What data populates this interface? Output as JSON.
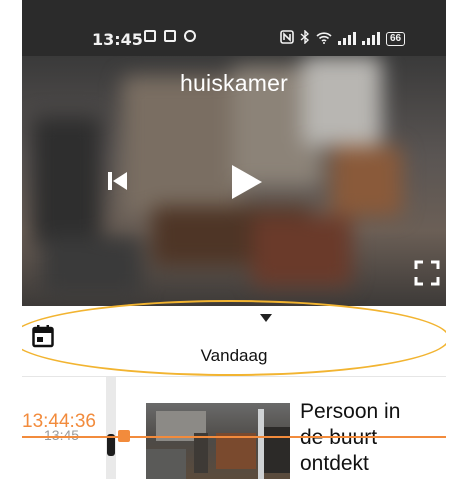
{
  "statusbar": {
    "time": "13:45",
    "left_icons": [
      "notification-icon",
      "notification-icon",
      "record-icon"
    ],
    "right_icons": [
      "nfc-icon",
      "bluetooth-icon",
      "wifi-icon",
      "signal-icon",
      "signal-icon"
    ],
    "battery": "66"
  },
  "camera": {
    "title": "huiskamer",
    "controls": [
      "skip-previous-icon",
      "play-icon",
      "fullscreen-icon"
    ]
  },
  "date_picker": {
    "label": "Vandaag",
    "icons": [
      "calendar-icon",
      "chevron-down-icon"
    ]
  },
  "timeline": {
    "current_time": "13:44:36",
    "tick_time": "13:45",
    "event": {
      "line1": "Persoon in",
      "line2": "de buurt",
      "line3": "ontdekt"
    }
  },
  "colors": {
    "accent": "#f28b3c",
    "highlight": "#f2b431",
    "statusbar_bg": "#2b2b2b"
  }
}
